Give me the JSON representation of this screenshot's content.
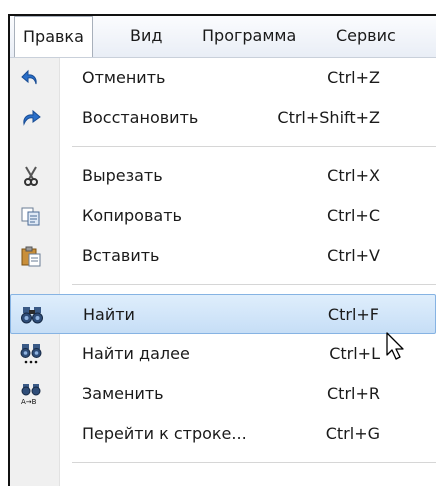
{
  "menubar": {
    "items": [
      {
        "label": "Правка",
        "active": true
      },
      {
        "label": "Вид"
      },
      {
        "label": "Программа"
      },
      {
        "label": "Сервис"
      }
    ]
  },
  "edit_menu": {
    "items": [
      {
        "label": "Отменить",
        "shortcut": "Ctrl+Z",
        "icon": "undo-icon"
      },
      {
        "label": "Восстановить",
        "shortcut": "Ctrl+Shift+Z",
        "icon": "redo-icon"
      },
      {
        "label": "Вырезать",
        "shortcut": "Ctrl+X",
        "icon": "scissors-icon"
      },
      {
        "label": "Копировать",
        "shortcut": "Ctrl+C",
        "icon": "copy-icon"
      },
      {
        "label": "Вставить",
        "shortcut": "Ctrl+V",
        "icon": "paste-icon"
      },
      {
        "label": "Найти",
        "shortcut": "Ctrl+F",
        "icon": "binoculars-icon",
        "highlighted": true
      },
      {
        "label": "Найти далее",
        "shortcut": "Ctrl+L",
        "icon": "find-next-icon"
      },
      {
        "label": "Заменить",
        "shortcut": "Ctrl+R",
        "icon": "replace-icon"
      },
      {
        "label": "Перейти к строке...",
        "shortcut": "Ctrl+G",
        "icon": ""
      }
    ]
  },
  "colors": {
    "highlight_bg": "#c6def6",
    "highlight_border": "#86b3e3",
    "undo_arrow": "#2a6fc9"
  }
}
